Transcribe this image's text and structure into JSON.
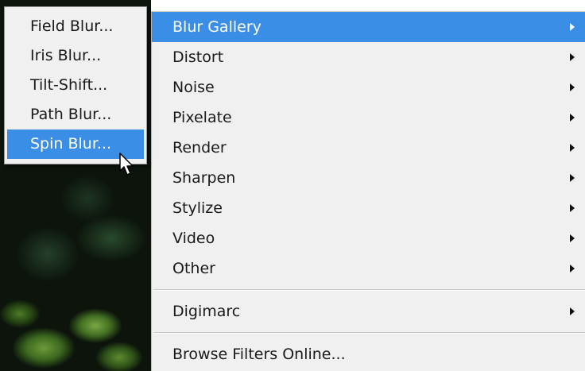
{
  "submenu": {
    "items": [
      {
        "label": "Field Blur..."
      },
      {
        "label": "Iris Blur..."
      },
      {
        "label": "Tilt-Shift..."
      },
      {
        "label": "Path Blur..."
      },
      {
        "label": "Spin Blur...",
        "highlighted": true
      }
    ]
  },
  "menu": {
    "items": [
      {
        "label": "Blur Gallery",
        "has_submenu": true,
        "highlighted": true
      },
      {
        "label": "Distort",
        "has_submenu": true
      },
      {
        "label": "Noise",
        "has_submenu": true
      },
      {
        "label": "Pixelate",
        "has_submenu": true
      },
      {
        "label": "Render",
        "has_submenu": true
      },
      {
        "label": "Sharpen",
        "has_submenu": true
      },
      {
        "label": "Stylize",
        "has_submenu": true
      },
      {
        "label": "Video",
        "has_submenu": true
      },
      {
        "label": "Other",
        "has_submenu": true
      }
    ],
    "digimarc": {
      "label": "Digimarc",
      "has_submenu": true
    },
    "browse": {
      "label": "Browse Filters Online..."
    }
  },
  "colors": {
    "highlight": "#3b8ee6",
    "menu_bg": "#f0f0f0"
  },
  "icons": {
    "submenu_arrow": "chevron-right-icon",
    "cursor": "mouse-pointer-icon"
  }
}
